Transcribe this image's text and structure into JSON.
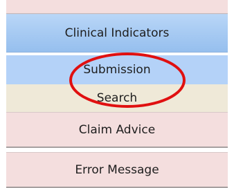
{
  "menu": {
    "items": [
      {
        "label": "Clinical Indicators"
      },
      {
        "label": "Submission"
      },
      {
        "label": "Search"
      },
      {
        "label": "Claim Advice"
      },
      {
        "label": "Error Message"
      }
    ]
  },
  "annotation": {
    "ring_color": "#e01010",
    "active_submenu_color": "#b4d2f8",
    "header_color": "#a5c9f2",
    "menu_color": "#f4dede",
    "search_color": "#efe9d8"
  }
}
